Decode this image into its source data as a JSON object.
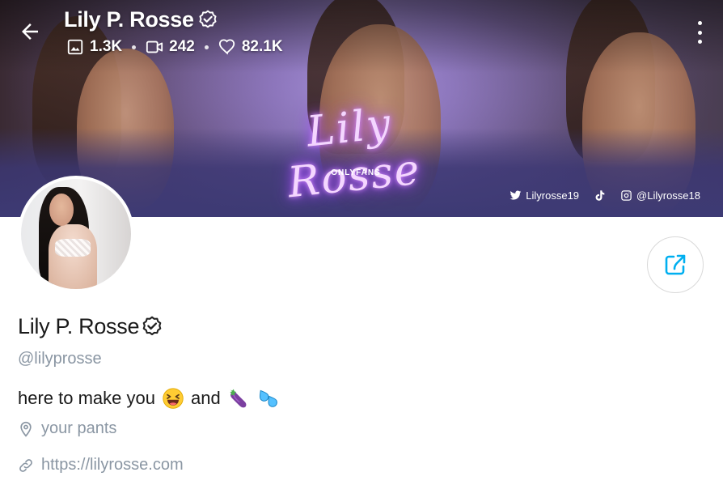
{
  "header": {
    "name": "Lily P. Rosse",
    "stats": [
      {
        "icon": "image-icon",
        "value": "1.3K"
      },
      {
        "icon": "video-icon",
        "value": "242"
      },
      {
        "icon": "heart-icon",
        "value": "82.1K"
      }
    ]
  },
  "cover": {
    "neon_text": "Lily Rosse",
    "neon_subtext": "ONLYFANS",
    "socials": [
      {
        "icon": "twitter-icon",
        "text": "Lilyrosse19"
      },
      {
        "icon": "tiktok-icon",
        "text": ""
      },
      {
        "icon": "instagram-icon",
        "text": "@Lilyrosse18"
      }
    ]
  },
  "profile": {
    "name": "Lily P. Rosse",
    "handle": "@lilyprosse",
    "bio_part1": "here to make you",
    "bio_part2": "and",
    "bio_emojis": [
      "laughing-face-emoji",
      "eggplant-emoji",
      "sweat-droplets-emoji"
    ],
    "location": "your pants",
    "link": "https://lilyrosse.com"
  },
  "colors": {
    "accent": "#00aff0",
    "muted_text": "#8a96a3",
    "banner_purple": "#8f7fb8"
  }
}
